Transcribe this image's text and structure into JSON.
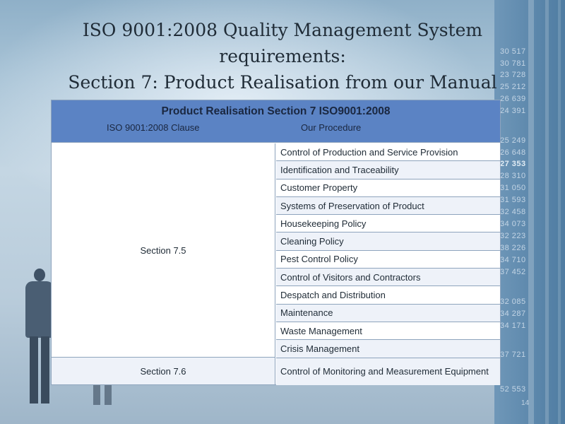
{
  "title_lines": [
    "ISO 9001:2008 Quality Management System",
    "requirements:",
    "Section 7: Product Realisation from our Manual"
  ],
  "table": {
    "title": "Product Realisation Section 7 ISO9001:2008",
    "col_clause": "ISO 9001:2008 Clause",
    "col_procedure": "Our Procedure",
    "groups": [
      {
        "clause": "Section 7.5",
        "procedures": [
          "Control of Production and Service Provision",
          "Identification and Traceability",
          "Customer Property",
          "Systems of Preservation of Product",
          "Housekeeping Policy",
          "Cleaning Policy",
          "Pest Control Policy",
          "Control of Visitors and Contractors",
          "Despatch and Distribution",
          "Maintenance",
          "Waste Management",
          "Crisis Management"
        ]
      },
      {
        "clause": "Section 7.6",
        "procedures": [
          "Control of Monitoring and Measurement Equipment"
        ]
      }
    ]
  },
  "side_numbers": [
    "30 517",
    "30 781",
    "23 728",
    "25 212",
    "26 639",
    "24 391",
    "25 249",
    "26 648",
    "27 353",
    "28 310",
    "31 050",
    "31 593",
    "32 458",
    "34 073",
    "32 223",
    "38 226",
    "34 710",
    "37 452",
    "32 085",
    "34 287",
    "34 171",
    "37 721",
    "52 553"
  ],
  "page_number": "14",
  "colors": {
    "header_fill": "#5b83c4",
    "row_alt": "#eef2f9",
    "border": "#8ea4bd"
  }
}
